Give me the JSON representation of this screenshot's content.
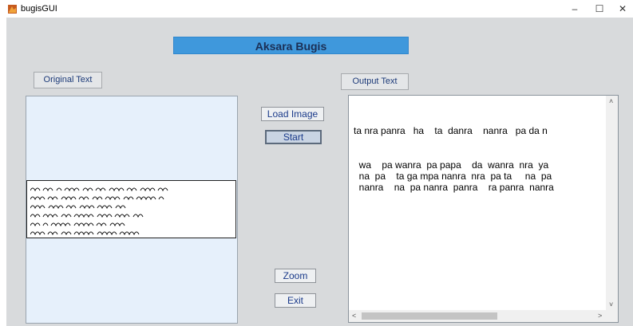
{
  "window": {
    "title": "bugisGUI",
    "minimize_label": "–",
    "maximize_label": "☐",
    "close_label": "✕"
  },
  "main": {
    "banner_title": "Aksara Bugis",
    "original_text_label": "Original Text",
    "output_text_label": "Output Text"
  },
  "buttons": {
    "load_image": "Load Image",
    "start": "Start",
    "zoom": "Zoom",
    "exit": "Exit"
  },
  "output": {
    "lines": [
      "ta nra panra   ha    ta  danra    nanra   pa da n",
      "  wa    pa wanra  pa papa    da  wanra  nra  ya",
      "  na  pa    ta ga mpa nanra  nra  pa ta     na  pa",
      "  nanra    na  pa nanra  panra    ra panra  nanra"
    ]
  },
  "scrollbar": {
    "up": "˄",
    "down": "˅",
    "left": "<",
    "right": ">"
  },
  "colors": {
    "client_bg": "#d8dadc",
    "banner_bg": "#3f98dc",
    "panel_bg": "#e6f0fb"
  }
}
